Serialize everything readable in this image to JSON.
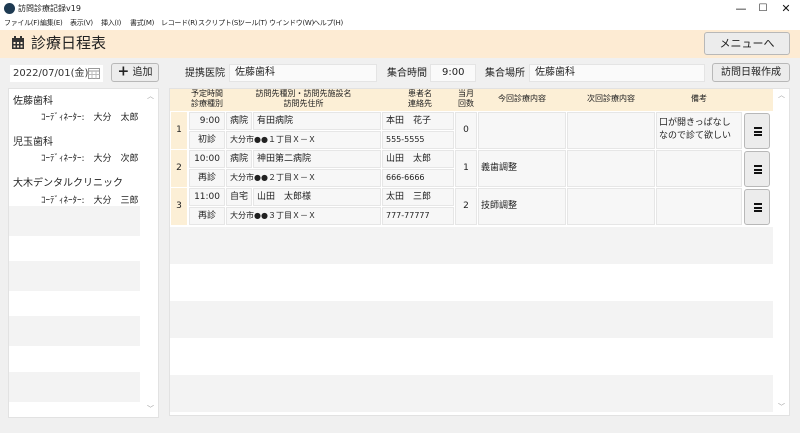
{
  "window": {
    "title": "訪問診療記録v19",
    "controls": {
      "minimize": "—",
      "maximize": "☐",
      "close": "✕"
    }
  },
  "menubar": [
    "ファイル(F)",
    "編集(E)",
    "表示(V)",
    "挿入(I)",
    "書式(M)",
    "レコード(R)",
    "スクリプト(S)",
    "ツール(T)",
    "ウインドウ(W)",
    "ヘルプ(H)"
  ],
  "header": {
    "title": "診療日程表",
    "menu_button": "メニューへ"
  },
  "toolbar": {
    "date": "2022/07/01(金)",
    "add_button": "追加",
    "partner_clinic_label": "提携医院",
    "partner_clinic_value": "佐藤歯科",
    "meeting_time_label": "集合時間",
    "meeting_time_value": "9:00",
    "meeting_place_label": "集合場所",
    "meeting_place_value": "佐藤歯科",
    "report_button": "訪問日報作成"
  },
  "left_panel": {
    "items": [
      {
        "name": "佐藤歯科",
        "coordinator": "ｺｰﾃﾞｨﾈｰﾀｰ:　大分　太郎"
      },
      {
        "name": "児玉歯科",
        "coordinator": "ｺｰﾃﾞｨﾈｰﾀｰ:　大分　次郎"
      },
      {
        "name": "大木デンタルクリニック",
        "coordinator": "ｺｰﾃﾞｨﾈｰﾀｰ:　大分　三郎"
      }
    ],
    "scroll_up": "︿",
    "scroll_down": "﹀"
  },
  "table": {
    "headers": {
      "time": "予定時間",
      "kind": "診療種別",
      "visit_type_name": "訪問先種別・訪問先施設名",
      "address": "訪問先住所",
      "patient": "患者名",
      "contact": "連絡先",
      "month1": "当月",
      "month2": "回数",
      "current": "今回診療内容",
      "next": "次回診療内容",
      "notes": "備考"
    },
    "rows": [
      {
        "index": "1",
        "time": "9:00",
        "kind": "初診",
        "place_type": "病院",
        "place_name": "有田病院",
        "address": "大分市●●１丁目Ｘ－Ｘ",
        "patient": "本田　花子",
        "phone": "555-5555",
        "count": "0",
        "current": "",
        "next": "",
        "notes": "口が開きっぱなしなので診て欲しい"
      },
      {
        "index": "2",
        "time": "10:00",
        "kind": "再診",
        "place_type": "病院",
        "place_name": "神田第二病院",
        "address": "大分市●●２丁目Ｘ－Ｘ",
        "patient": "山田　太郎",
        "phone": "666-6666",
        "count": "1",
        "current": "義歯調整",
        "next": "",
        "notes": ""
      },
      {
        "index": "3",
        "time": "11:00",
        "kind": "再診",
        "place_type": "自宅",
        "place_name": "山田　太郎様",
        "address": "大分市●●３丁目Ｘ－Ｘ",
        "patient": "太田　三郎",
        "phone": "777-77777",
        "count": "2",
        "current": "技師調整",
        "next": "",
        "notes": ""
      }
    ],
    "scroll_up": "︿",
    "scroll_down": "﹀"
  },
  "icons": {
    "calendar": "calendar-icon",
    "plus": "plus-icon",
    "menu": "hamburger-icon"
  },
  "colors": {
    "header_bg": "#fdebd3",
    "table_header_bg": "#fcefd6",
    "app_icon": "#1e3a52"
  }
}
